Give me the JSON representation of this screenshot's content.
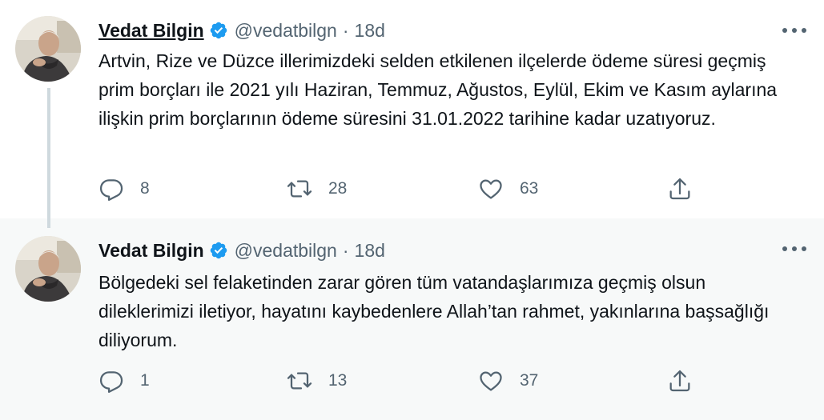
{
  "colors": {
    "verified": "#1d9bf0",
    "text_primary": "#0f1419",
    "text_secondary": "#536471",
    "thread_line": "#cfd9de",
    "reply_background": "#f7f9f9"
  },
  "tweets": [
    {
      "author_name": "Vedat Bilgin",
      "handle": "@vedatbilgn",
      "separator": "·",
      "time": "18d",
      "verified_icon": "verified-badge-icon",
      "text": "Artvin, Rize ve Düzce illerimizdeki selden etkilenen ilçelerde ödeme süresi geçmiş prim borçları ile 2021 yılı Haziran, Temmuz, Ağustos, Eylül, Ekim ve Kasım aylarına ilişkin prim borçlarının ödeme süresini 31.01.2022 tarihine kadar uzatıyoruz.",
      "replies": "8",
      "retweets": "28",
      "likes": "63"
    },
    {
      "author_name": "Vedat Bilgin",
      "handle": "@vedatbilgn",
      "separator": "·",
      "time": "18d",
      "verified_icon": "verified-badge-icon",
      "text": "Bölgedeki sel felaketinden zarar gören tüm vatandaşlarımıza geçmiş olsun dileklerimizi iletiyor, hayatını kaybedenlere Allah’tan rahmet, yakınlarına başsağlığı diliyorum.",
      "replies": "1",
      "retweets": "13",
      "likes": "37"
    }
  ]
}
